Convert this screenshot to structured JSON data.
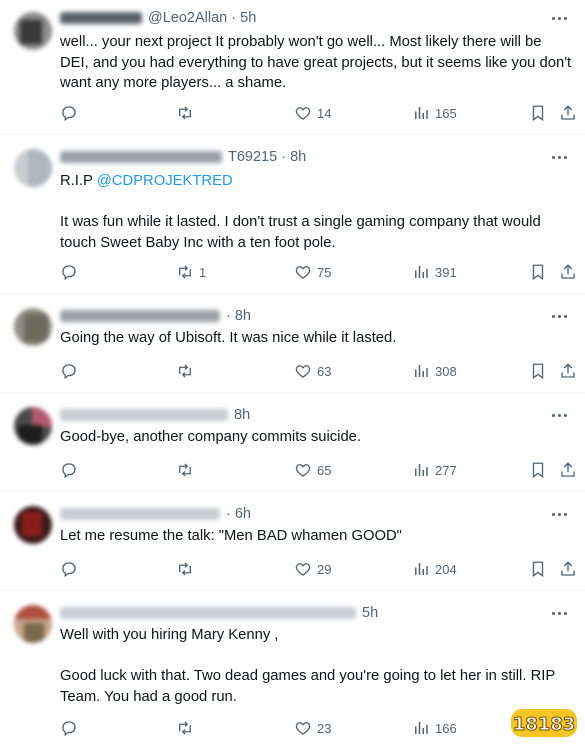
{
  "tweets": [
    {
      "handle": "@Leo2Allan",
      "time": "5h",
      "lines": [
        "well... your next project It probably won't go well... Most likely there will be DEI, and you had everything to have great projects, but it seems like you don't want any more players... a shame."
      ],
      "replies": "",
      "retweets": "",
      "likes": "14",
      "views": "165"
    },
    {
      "handle": "T69215",
      "time": "8h",
      "rip_prefix": "R.I.P",
      "mention": "@CDPROJEKTRED",
      "lines": [
        "It was fun while it lasted. I don't trust a single gaming company that would touch Sweet Baby Inc with a ten foot pole."
      ],
      "replies": "",
      "retweets": "1",
      "likes": "75",
      "views": "391"
    },
    {
      "handle": "",
      "time": "8h",
      "lines": [
        "Going the way of Ubisoft. It was nice while it lasted."
      ],
      "replies": "",
      "retweets": "",
      "likes": "63",
      "views": "308"
    },
    {
      "handle": "",
      "time": "8h",
      "lines": [
        "Good-bye, another company commits suicide."
      ],
      "replies": "",
      "retweets": "",
      "likes": "65",
      "views": "277"
    },
    {
      "handle": "",
      "time": "6h",
      "lines": [
        "Let me resume the talk: \"Men BAD whamen GOOD\""
      ],
      "replies": "",
      "retweets": "",
      "likes": "29",
      "views": "204"
    },
    {
      "handle": "",
      "time": "5h",
      "lines": [
        "Well with you hiring Mary Kenny ,",
        "Good luck with that. Two dead games and you're going to let her in still. RIP Team. You had a good run."
      ],
      "replies": "",
      "retweets": "",
      "likes": "23",
      "views": "166"
    }
  ],
  "watermark": "18183",
  "colors": {
    "text": "#0f1419",
    "muted": "#536471",
    "link": "#1d9bf0",
    "divider": "#eff3f4"
  }
}
